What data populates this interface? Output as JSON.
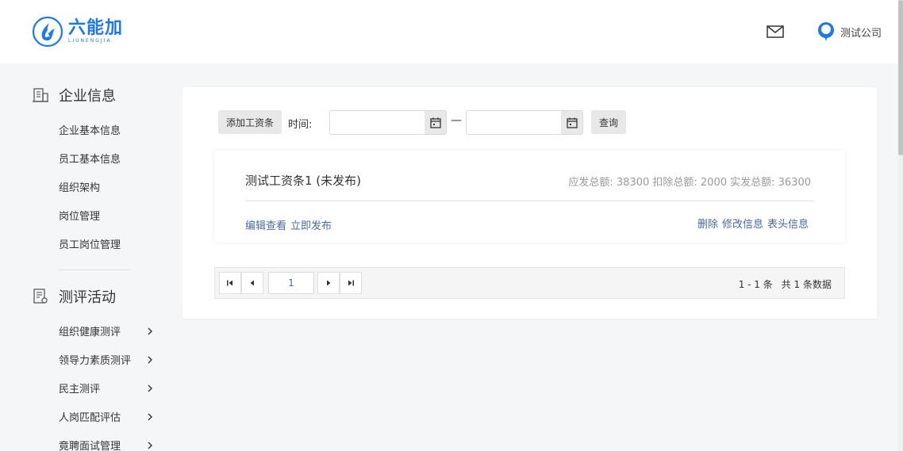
{
  "header": {
    "logo_cn": "六能加",
    "logo_en": "LIUNENGJIA",
    "user_name": "测试公司"
  },
  "sidebar": {
    "sections": [
      {
        "title": "企业信息",
        "icon": "building-icon",
        "items": [
          {
            "label": "企业基本信息"
          },
          {
            "label": "员工基本信息"
          },
          {
            "label": "组织架构"
          },
          {
            "label": "岗位管理"
          },
          {
            "label": "员工岗位管理"
          }
        ]
      },
      {
        "title": "测评活动",
        "icon": "assessment-icon",
        "items": [
          {
            "label": "组织健康测评",
            "has_arrow": true
          },
          {
            "label": "领导力素质测评",
            "has_arrow": true
          },
          {
            "label": "民主测评",
            "has_arrow": true
          },
          {
            "label": "人岗匹配评估",
            "has_arrow": true
          },
          {
            "label": "竟聘面试管理",
            "has_arrow": true
          }
        ]
      }
    ]
  },
  "toolbar": {
    "add_label": "添加工资条",
    "time_label": "时间:",
    "start_date": {
      "value": "",
      "placeholder": ""
    },
    "end_date": {
      "value": "",
      "placeholder": ""
    },
    "range_sep": "—",
    "query_label": "查询"
  },
  "salary_card": {
    "title": "测试工资条1 (未发布)",
    "summary": "应发总额: 38300 扣除总额: 2000 实发总额: 36300",
    "actions_left": [
      "编辑查看",
      "立即发布"
    ],
    "actions_right": [
      "删除",
      "修改信息",
      "表头信息"
    ]
  },
  "pagination": {
    "current_page": "1",
    "range_text": "1 - 1 条",
    "total_text": "共 1 条数据"
  },
  "colors": {
    "brand": "#1e78e6",
    "link": "#4a6aa0",
    "muted": "#999999"
  }
}
